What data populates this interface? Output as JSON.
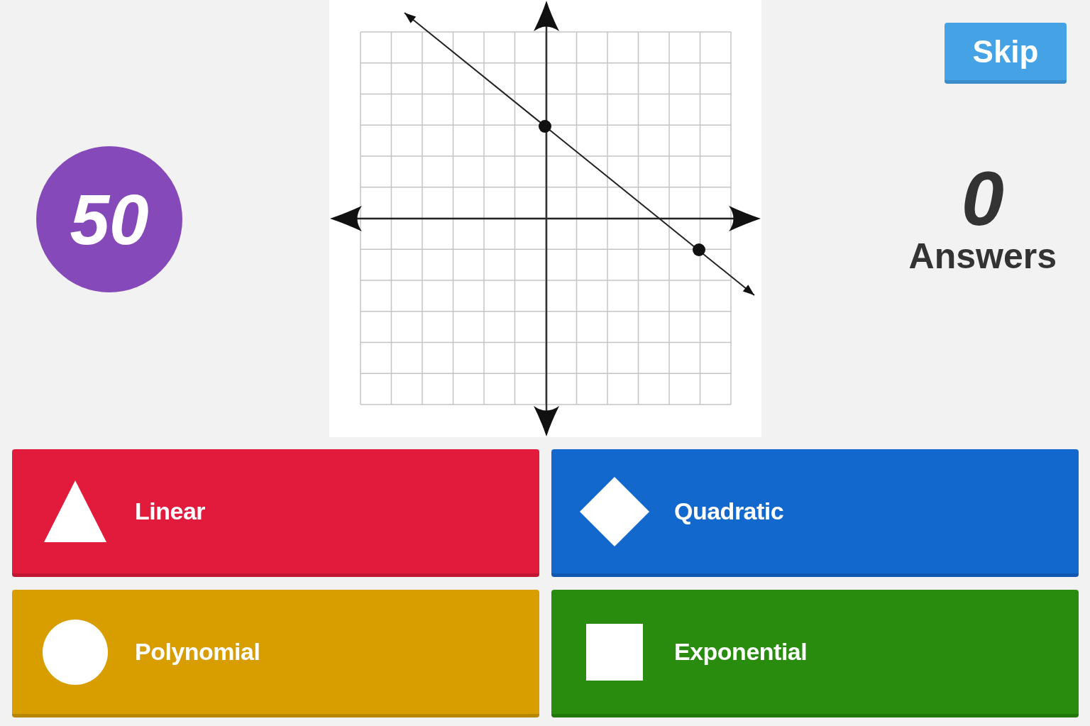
{
  "timer": {
    "value": "50"
  },
  "skip_button": {
    "label": "Skip"
  },
  "answer_counter": {
    "count": "0",
    "label": "Answers"
  },
  "answers": [
    {
      "kind": "triangle",
      "label": "Linear",
      "color": "#e21b3c"
    },
    {
      "kind": "diamond",
      "label": "Quadratic",
      "color": "#1368ce"
    },
    {
      "kind": "circle",
      "label": "Polynomial",
      "color": "#d89e00"
    },
    {
      "kind": "square",
      "label": "Exponential",
      "color": "#298c0e"
    }
  ]
}
